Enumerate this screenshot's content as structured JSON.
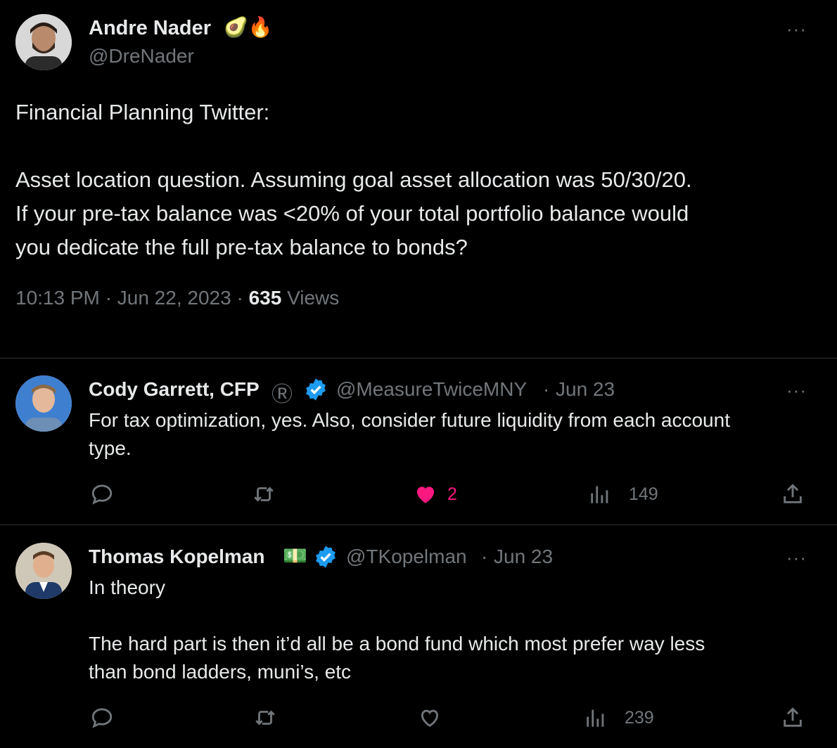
{
  "tweet": {
    "author_name": "Andre Nader",
    "author_emoji": "🥑🔥",
    "author_handle": "@DreNader",
    "text_lines": [
      "Financial Planning Twitter:",
      "",
      "Asset location question. Assuming goal asset allocation was 50/30/20.",
      "If your pre-tax balance was <20% of your total portfolio balance would",
      "you dedicate the full pre-tax balance to bonds?"
    ],
    "time": "10:13 PM",
    "date": "Jun 22, 2023",
    "views_count": "635",
    "views_label": "Views",
    "more": "···"
  },
  "replies": [
    {
      "name": "Cody Garrett, CFP",
      "name_symbol": "Ⓡ",
      "handle": "@MeasureTwiceMNY",
      "date": "Jun 23",
      "text_lines": [
        "For tax optimization, yes. Also, consider future liquidity from each account",
        "type."
      ],
      "likes": "2",
      "views": "149",
      "liked": true,
      "more": "···"
    },
    {
      "name": "Thomas Kopelman",
      "name_emoji": "💵",
      "handle": "@TKopelman",
      "date": "Jun 23",
      "text_lines": [
        "In theory",
        "",
        "The hard part is then it’d all be a bond fund which most prefer way less",
        "than bond ladders, muni’s, etc"
      ],
      "views": "239",
      "liked": false,
      "more": "···"
    }
  ],
  "colors": {
    "background": "#000000",
    "text": "#e7e9ea",
    "muted": "#71767b",
    "like": "#f91880",
    "verified": "#1d9bf0",
    "divider": "#2f3336"
  }
}
